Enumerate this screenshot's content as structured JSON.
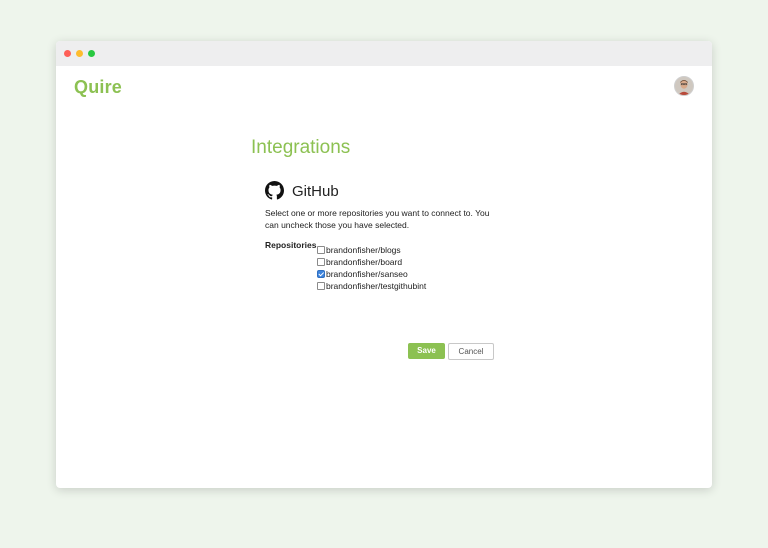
{
  "app": {
    "logo_text": "Quire"
  },
  "page": {
    "title": "Integrations"
  },
  "integration": {
    "name": "GitHub",
    "icon": "github-icon",
    "description": "Select one or more repositories you want to connect to. You can uncheck those you have selected."
  },
  "repositories": {
    "label": "Repositories",
    "items": [
      {
        "name": "brandonfisher/blogs",
        "checked": false
      },
      {
        "name": "brandonfisher/board",
        "checked": false
      },
      {
        "name": "brandonfisher/sanseo",
        "checked": true
      },
      {
        "name": "brandonfisher/testgithubint",
        "checked": false
      }
    ]
  },
  "actions": {
    "save_label": "Save",
    "cancel_label": "Cancel"
  },
  "colors": {
    "brand": "#8cc152",
    "checkbox_checked": "#3d84dd",
    "background": "#eef5ec"
  }
}
